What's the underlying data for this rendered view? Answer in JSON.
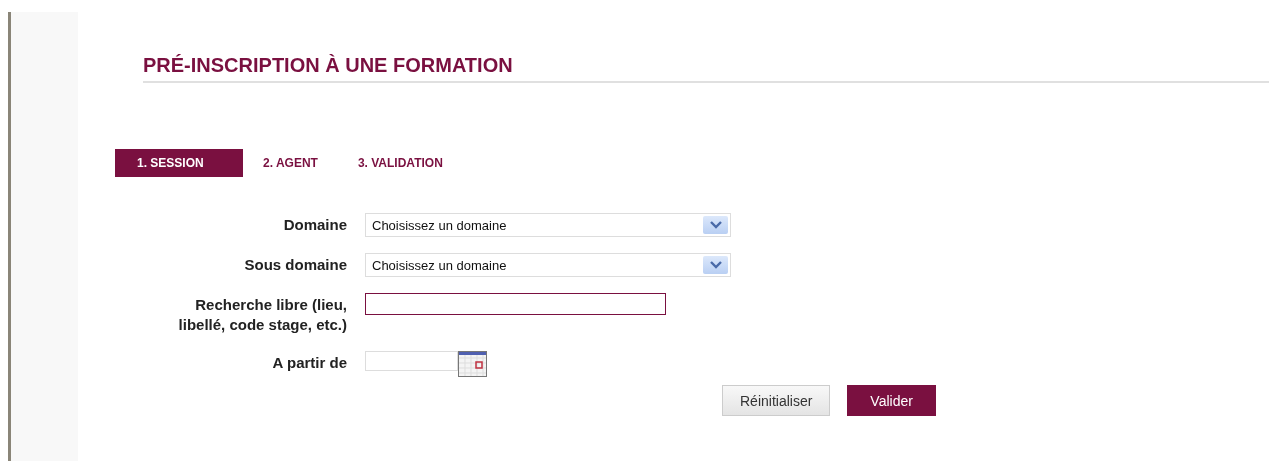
{
  "title": "PRÉ-INSCRIPTION À UNE FORMATION",
  "steps": [
    {
      "label": "1. SESSION",
      "selected": true
    },
    {
      "label": "2. AGENT",
      "selected": false
    },
    {
      "label": "3. VALIDATION",
      "selected": false
    }
  ],
  "fields": [
    {
      "kind": "select",
      "label": "Domaine",
      "value": "Choisissez un domaine"
    },
    {
      "kind": "select",
      "label": "Sous domaine",
      "value": "Choisissez un domaine"
    },
    {
      "kind": "text",
      "label": "Recherche libre (lieu, libellé, code stage, etc.)",
      "focused": true
    },
    {
      "kind": "date",
      "label": "A partir de"
    }
  ],
  "buttons": [
    {
      "label": "Réinitialiser",
      "primary": false
    },
    {
      "label": "Valider",
      "primary": true
    }
  ]
}
